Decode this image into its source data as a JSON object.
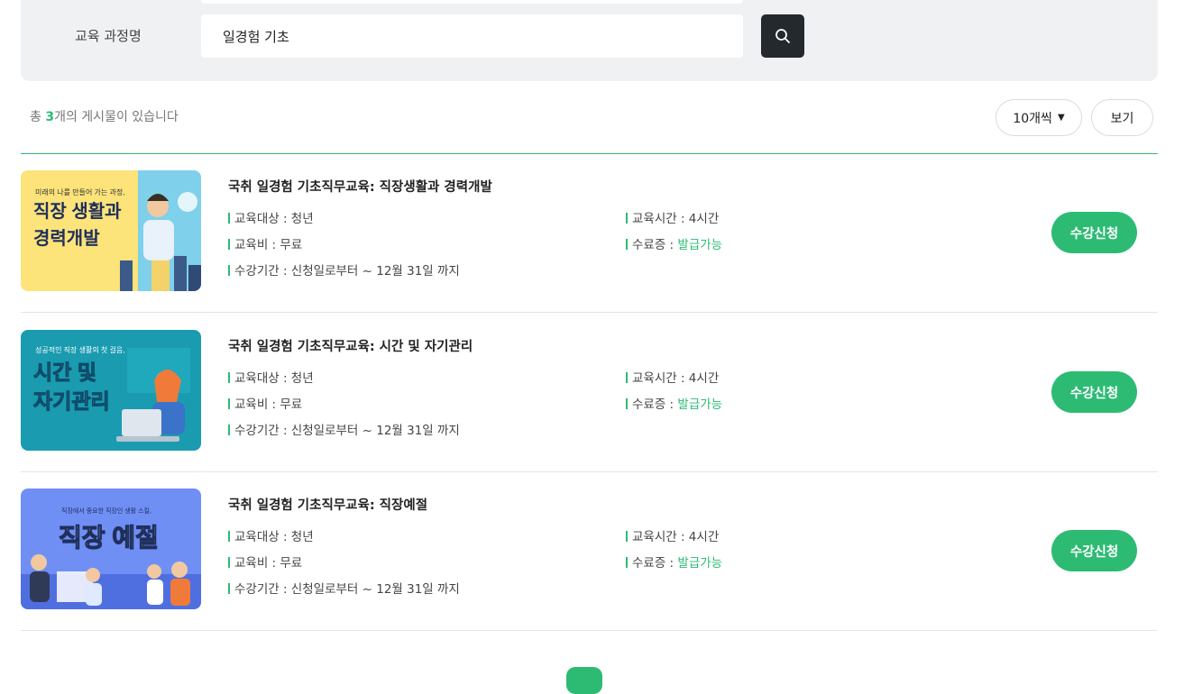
{
  "search": {
    "course_label": "교육 과정명",
    "course_value": "일경험 기초",
    "search_icon": "search-icon"
  },
  "list_header": {
    "total_prefix": "총 ",
    "total_count": "3",
    "total_suffix": "개의 게시물이 있습니다",
    "per_page": "10개씩",
    "view_label": "보기"
  },
  "courses": [
    {
      "title": "국취 일경험 기초직무교육: 직장생활과 경력개발",
      "target": "교육대상 : 청년",
      "fee": "교육비 : 무료",
      "period": "수강기간 : 신청일로부터 ~ 12월 31일 까지",
      "hours": "교육시간 : 4시간",
      "cert_label": "수료증 : ",
      "cert_value": "발급가능",
      "apply": "수강신청",
      "thumb": {
        "subtitle": "미래의 나를 만들어 가는 과정,",
        "line1": "직장 생활과",
        "line2": "경력개발",
        "bg": "#fce37a"
      }
    },
    {
      "title": "국취 일경험 기초직무교육: 시간 및 자기관리",
      "target": "교육대상 : 청년",
      "fee": "교육비 : 무료",
      "period": "수강기간 : 신청일로부터 ~ 12월 31일 까지",
      "hours": "교육시간 : 4시간",
      "cert_label": "수료증 : ",
      "cert_value": "발급가능",
      "apply": "수강신청",
      "thumb": {
        "subtitle": "성공적인 직장 생활의 첫 걸음,",
        "line1": "시간 및",
        "line2": "자기관리",
        "bg": "#1a9bb0"
      }
    },
    {
      "title": "국취 일경험 기초직무교육: 직장예절",
      "target": "교육대상 : 청년",
      "fee": "교육비 : 무료",
      "period": "수강기간 : 신청일로부터 ~ 12월 31일 까지",
      "hours": "교육시간 : 4시간",
      "cert_label": "수료증 : ",
      "cert_value": "발급가능",
      "apply": "수강신청",
      "thumb": {
        "subtitle": "직장에서 중요한 직장인 생활 스킬,",
        "line1": "직장 예절",
        "line2": "",
        "bg": "#6f8ff5"
      }
    }
  ],
  "colors": {
    "accent": "#2dbb74",
    "search_button": "#24292e",
    "panel": "#f0f1f3"
  }
}
